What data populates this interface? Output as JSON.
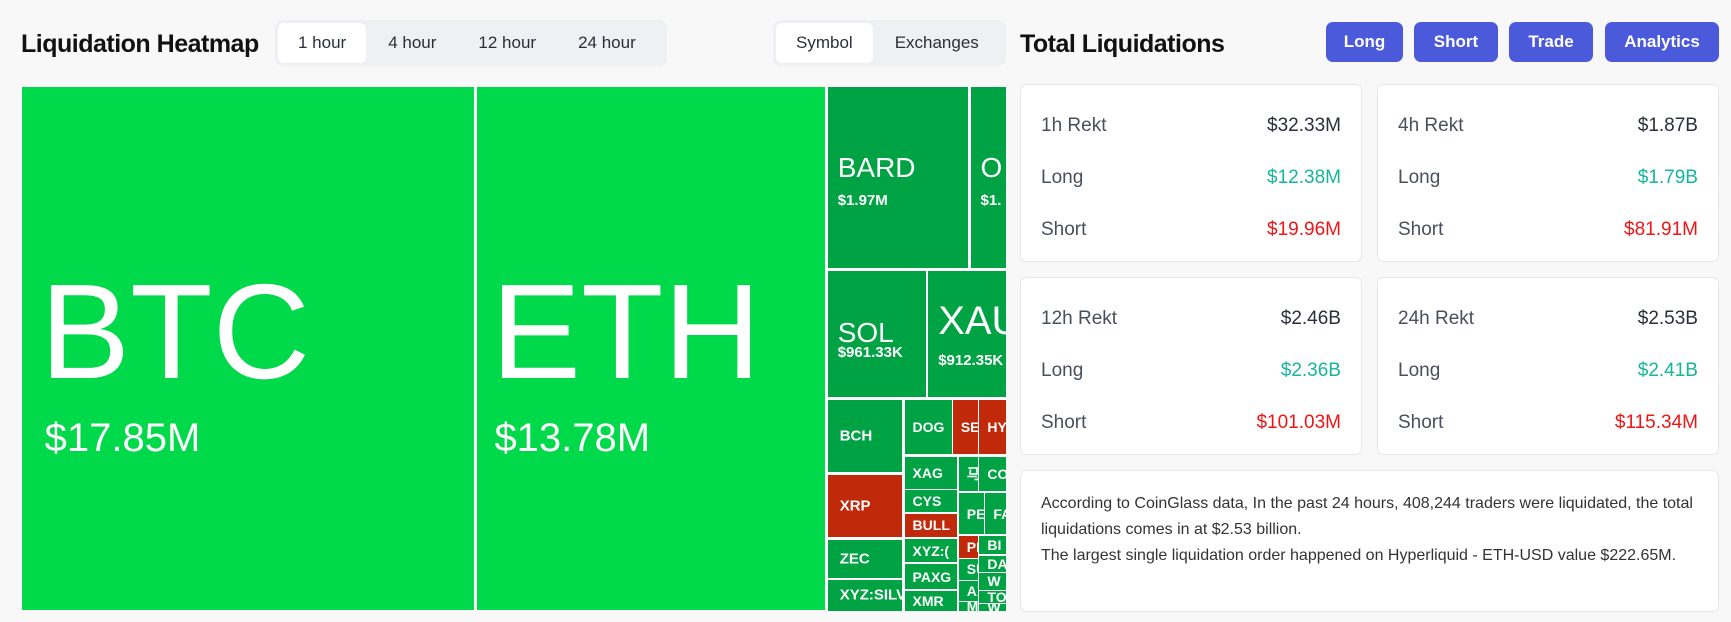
{
  "heatmap": {
    "title": "Liquidation Heatmap",
    "time_tabs": [
      "1 hour",
      "4 hour",
      "12 hour",
      "24 hour"
    ],
    "active_time_tab": "1 hour",
    "group_tabs": [
      "Symbol",
      "Exchanges"
    ],
    "active_group_tab": "Symbol",
    "colors": {
      "large_long": "#00d94a",
      "long": "#00a344",
      "short": "#c0290a"
    },
    "tiles": [
      {
        "symbol": "BTC",
        "value": "$17.85M",
        "side": "large_long"
      },
      {
        "symbol": "ETH",
        "value": "$13.78M",
        "side": "large_long"
      },
      {
        "symbol": "BARD",
        "value": "$1.97M",
        "side": "long"
      },
      {
        "symbol": "O",
        "value": "$1.",
        "side": "long"
      },
      {
        "symbol": "SOL",
        "value": "$961.33K",
        "side": "long"
      },
      {
        "symbol": "XAU",
        "value": "$912.35K",
        "side": "long"
      },
      {
        "symbol": "BCH",
        "value": "",
        "side": "long"
      },
      {
        "symbol": "XRP",
        "value": "",
        "side": "short"
      },
      {
        "symbol": "ZEC",
        "value": "",
        "side": "long"
      },
      {
        "symbol": "XYZ:SILV",
        "value": "",
        "side": "long"
      },
      {
        "symbol": "DOG",
        "value": "",
        "side": "long"
      },
      {
        "symbol": "SEN",
        "value": "",
        "side": "short"
      },
      {
        "symbol": "HY",
        "value": "",
        "side": "short"
      },
      {
        "symbol": "XAG",
        "value": "",
        "side": "long"
      },
      {
        "symbol": "CYS",
        "value": "",
        "side": "long"
      },
      {
        "symbol": "BULL",
        "value": "",
        "side": "short"
      },
      {
        "symbol": "XYZ:(",
        "value": "",
        "side": "long"
      },
      {
        "symbol": "PAXG",
        "value": "",
        "side": "long"
      },
      {
        "symbol": "XMR",
        "value": "",
        "side": "long"
      },
      {
        "symbol": "马",
        "value": "",
        "side": "long"
      },
      {
        "symbol": "CO",
        "value": "",
        "side": "long"
      },
      {
        "symbol": "PE",
        "value": "",
        "side": "long"
      },
      {
        "symbol": "FA",
        "value": "",
        "side": "long"
      },
      {
        "symbol": "PN",
        "value": "",
        "side": "short"
      },
      {
        "symbol": "SU",
        "value": "",
        "side": "long"
      },
      {
        "symbol": "AX",
        "value": "",
        "side": "long"
      },
      {
        "symbol": "MC",
        "value": "",
        "side": "long"
      },
      {
        "symbol": "BI",
        "value": "",
        "side": "long"
      },
      {
        "symbol": "DA",
        "value": "",
        "side": "long"
      },
      {
        "symbol": "W",
        "value": "",
        "side": "long"
      },
      {
        "symbol": "TO",
        "value": "",
        "side": "long"
      },
      {
        "symbol": "W",
        "value": "",
        "side": "long"
      }
    ]
  },
  "totals": {
    "title": "Total Liquidations",
    "buttons": [
      "Long",
      "Short",
      "Trade",
      "Analytics"
    ],
    "accent": "#4b59db",
    "cards": [
      {
        "label": "1h Rekt",
        "total": "$32.33M",
        "long_label": "Long",
        "long": "$12.38M",
        "short_label": "Short",
        "short": "$19.96M"
      },
      {
        "label": "4h Rekt",
        "total": "$1.87B",
        "long_label": "Long",
        "long": "$1.79B",
        "short_label": "Short",
        "short": "$81.91M"
      },
      {
        "label": "12h Rekt",
        "total": "$2.46B",
        "long_label": "Long",
        "long": "$2.36B",
        "short_label": "Short",
        "short": "$101.03M"
      },
      {
        "label": "24h Rekt",
        "total": "$2.53B",
        "long_label": "Long",
        "long": "$2.41B",
        "short_label": "Short",
        "short": "$115.34M"
      }
    ],
    "summary_line1": "According to CoinGlass data, In the past 24 hours, 408,244 traders were liquidated, the total liquidations comes in at $2.53 billion.",
    "summary_line2": "The largest single liquidation order happened on Hyperliquid - ETH-USD value $222.65M."
  }
}
